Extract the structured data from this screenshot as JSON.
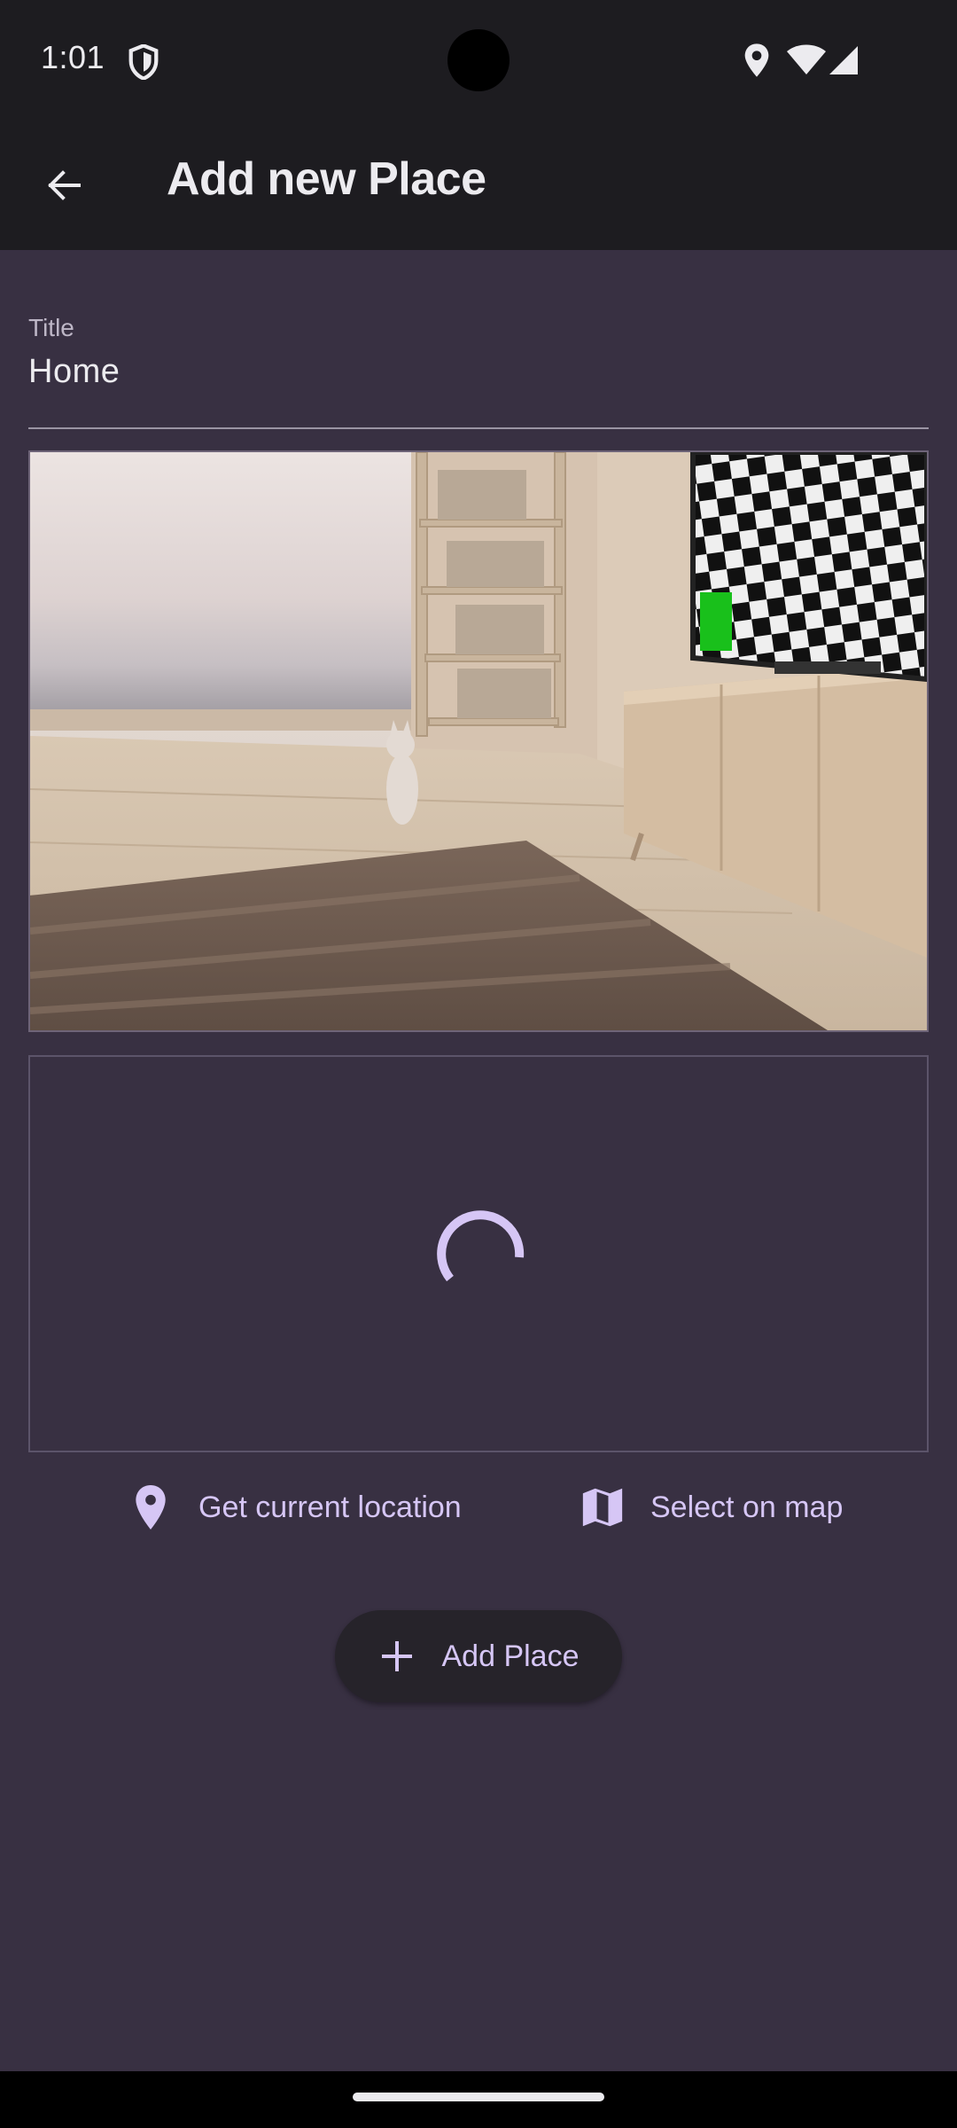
{
  "status_bar": {
    "time": "1:01",
    "icons": [
      "shield-icon",
      "location-icon",
      "wifi-icon",
      "signal-icon"
    ]
  },
  "app_bar": {
    "title": "Add new Place",
    "back_icon": "arrow-back-icon"
  },
  "form": {
    "title_label": "Title",
    "title_value": "Home"
  },
  "location_preview": {
    "state": "loading"
  },
  "actions": {
    "current_location": "Get current location",
    "select_on_map": "Select on map",
    "add_place": "Add Place"
  },
  "colors": {
    "background": "#383042",
    "app_bar": "#1d1c20",
    "accent": "#d6c6f5",
    "text": "#ecebef"
  }
}
